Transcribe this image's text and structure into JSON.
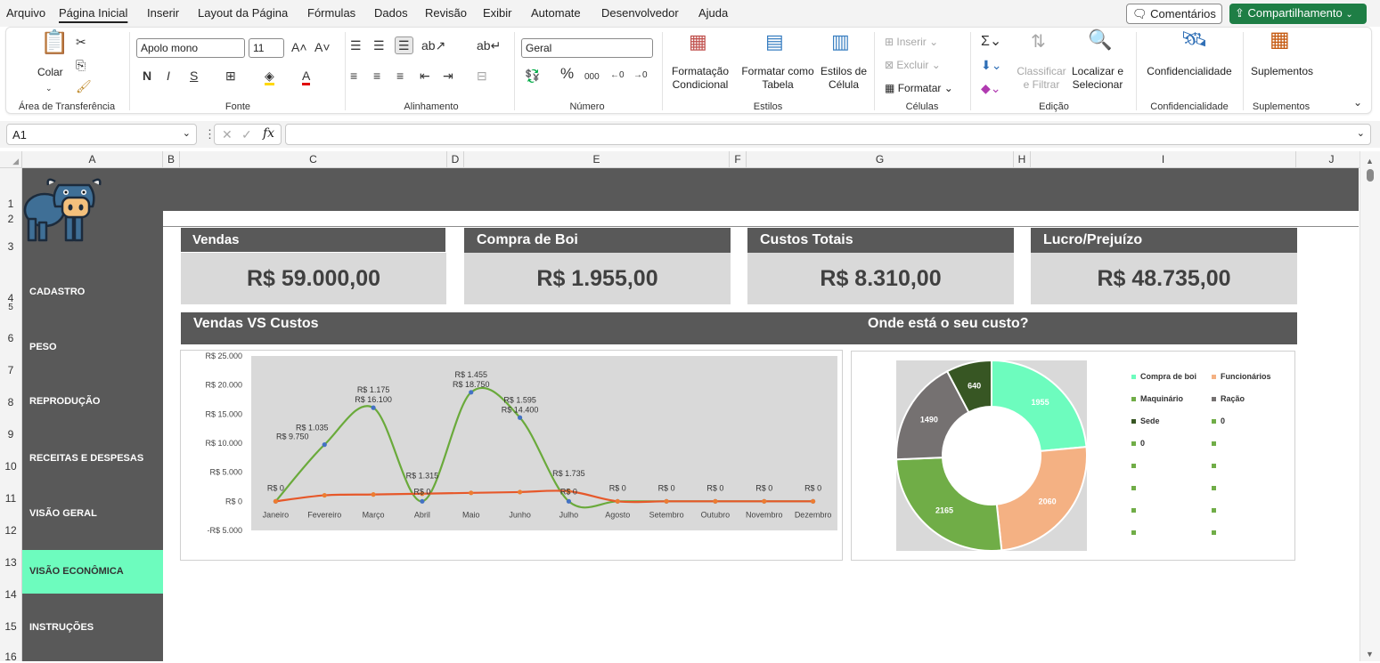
{
  "menu": {
    "tabs": [
      "Arquivo",
      "Página Inicial",
      "Inserir",
      "Layout da Página",
      "Fórmulas",
      "Dados",
      "Revisão",
      "Exibir",
      "Automate",
      "Desenvolvedor",
      "Ajuda"
    ],
    "comments_label": "Comentários",
    "share_label": "Compartilhamento"
  },
  "ribbon": {
    "clipboard": {
      "paste_label": "Colar",
      "group_label": "Área de Transferência"
    },
    "font": {
      "font_name": "Apolo mono",
      "font_size": "11",
      "group_label": "Fonte"
    },
    "alignment": {
      "group_label": "Alinhamento"
    },
    "number": {
      "format": "Geral",
      "group_label": "Número"
    },
    "styles": {
      "cond_format": "Formatação Condicional",
      "format_table": "Formatar como Tabela",
      "cell_styles": "Estilos de Célula",
      "group_label": "Estilos"
    },
    "cells": {
      "insert": "Inserir",
      "delete": "Excluir",
      "format": "Formatar",
      "group_label": "Células"
    },
    "editing": {
      "sort_filter": "Classificar e Filtrar",
      "find_select": "Localizar e Selecionar",
      "group_label": "Edição"
    },
    "sensitivity": {
      "label": "Confidencialidade",
      "group_label": "Confidencialidade"
    },
    "addins": {
      "label": "Suplementos",
      "group_label": "Suplementos"
    }
  },
  "formula_bar": {
    "name_box": "A1",
    "formula": ""
  },
  "columns": [
    "A",
    "B",
    "C",
    "D",
    "E",
    "F",
    "G",
    "H",
    "I",
    "J"
  ],
  "rows": [
    "1",
    "2",
    "3",
    "4",
    "5",
    "6",
    "7",
    "8",
    "9",
    "10",
    "11",
    "12",
    "13",
    "14",
    "15",
    "16"
  ],
  "nav": [
    {
      "label": "CADASTRO"
    },
    {
      "label": "PESO"
    },
    {
      "label": "REPRODUÇÃO"
    },
    {
      "label": "RECEITAS E DESPESAS"
    },
    {
      "label": "VISÃO GERAL"
    },
    {
      "label": "VISÃO ECONÔMICA",
      "active": true
    },
    {
      "label": "INSTRUÇÕES"
    }
  ],
  "kpis": [
    {
      "title": "Vendas",
      "value": "R$ 59.000,00"
    },
    {
      "title": "Compra de Boi",
      "value": "R$ 1.955,00"
    },
    {
      "title": "Custos Totais",
      "value": "R$ 8.310,00"
    },
    {
      "title": "Lucro/Prejuízo",
      "value": "R$ 48.735,00"
    }
  ],
  "section_titles": {
    "left": "Vendas VS Custos",
    "right": "Onde está o seu custo?"
  },
  "colors": {
    "dark": "#595959",
    "nav_active": "#6dfcbe",
    "sales_line": "#6aaa3b",
    "cost_line": "#e6582a",
    "green_btn": "#1e7e45"
  },
  "chart_data": [
    {
      "type": "line",
      "categories": [
        "Janeiro",
        "Fevereiro",
        "Março",
        "Abril",
        "Maio",
        "Junho",
        "Julho",
        "Agosto",
        "Setembro",
        "Outubro",
        "Novembro",
        "Dezembro"
      ],
      "ylim": [
        -5000,
        25000
      ],
      "yticks": [
        "-R$ 5.000",
        "R$ 0",
        "R$ 5.000",
        "R$ 10.000",
        "R$ 15.000",
        "R$ 20.000",
        "R$ 25.000"
      ],
      "series": [
        {
          "values": [
            0,
            9750,
            16100,
            0,
            18750,
            14400,
            0,
            0,
            0,
            0,
            0,
            0
          ],
          "color": "#6aaa3b",
          "labels": [
            "",
            "R$ 9.750",
            "R$ 16.100",
            "R$ 0",
            "R$ 18.750",
            "R$ 14.400",
            "R$ 0",
            "",
            "",
            "",
            "",
            ""
          ]
        },
        {
          "values": [
            0,
            1035,
            1175,
            1315,
            1455,
            1595,
            1735,
            0,
            0,
            0,
            0,
            0
          ],
          "color": "#e6582a",
          "labels": [
            "R$ 0",
            "R$ 1.035",
            "R$ 1.175",
            "R$ 1.315",
            "R$ 1.455",
            "R$ 1.595",
            "R$ 1.735",
            "R$ 0",
            "R$ 0",
            "R$ 0",
            "R$ 0",
            "R$ 0"
          ]
        }
      ],
      "grid": false
    },
    {
      "type": "pie",
      "donut": true,
      "slices": [
        {
          "name": "Compra de boi",
          "value": 1955,
          "color": "#6dfcbe"
        },
        {
          "name": "Funcionários",
          "value": 2060,
          "color": "#f4b183"
        },
        {
          "name": "Maquinário",
          "value": 2165,
          "color": "#70ad47"
        },
        {
          "name": "Ração",
          "value": 1490,
          "color": "#757171"
        },
        {
          "name": "Sede",
          "value": 640,
          "color": "#375623"
        },
        {
          "name": "0",
          "value": 0,
          "color": "#70ad47"
        },
        {
          "name": "0",
          "value": 0,
          "color": "#70ad47"
        }
      ],
      "legend_position": "right"
    }
  ]
}
